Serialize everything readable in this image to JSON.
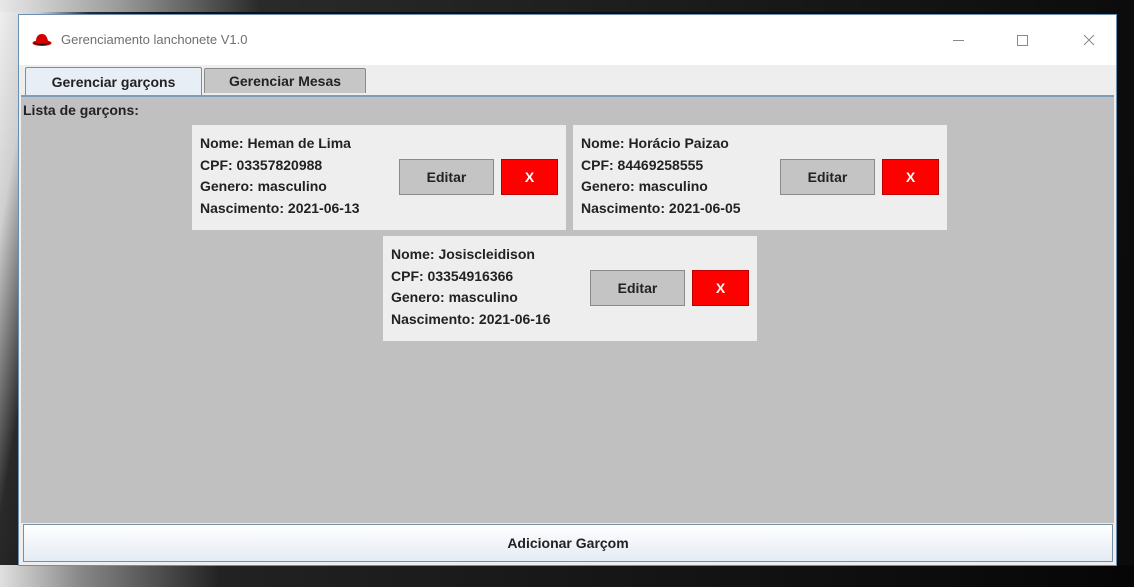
{
  "window": {
    "title": "Gerenciamento lanchonete V1.0",
    "icon": "red-hat-icon"
  },
  "tabs": [
    {
      "label": "Gerenciar garçons",
      "active": true
    },
    {
      "label": "Gerenciar Mesas",
      "active": false
    }
  ],
  "content": {
    "list_label": "Lista de garçons:",
    "waiters": [
      {
        "nome": "Nome: Heman de Lima",
        "cpf": "CPF: 03357820988",
        "genero": "Genero: masculino",
        "nascimento": "Nascimento: 2021-06-13",
        "edit_label": "Editar",
        "delete_label": "X"
      },
      {
        "nome": "Nome: Horácio Paizao",
        "cpf": "CPF: 84469258555",
        "genero": "Genero: masculino",
        "nascimento": "Nascimento: 2021-06-05",
        "edit_label": "Editar",
        "delete_label": "X"
      },
      {
        "nome": "Nome: Josiscleidison",
        "cpf": "CPF: 03354916366",
        "genero": "Genero: masculino",
        "nascimento": "Nascimento: 2021-06-16",
        "edit_label": "Editar",
        "delete_label": "X"
      }
    ]
  },
  "footer": {
    "add_label": "Adicionar Garçom"
  },
  "colors": {
    "delete_button": "#ff0000",
    "content_bg": "#c0c0c0",
    "card_bg": "#eeeeee"
  }
}
